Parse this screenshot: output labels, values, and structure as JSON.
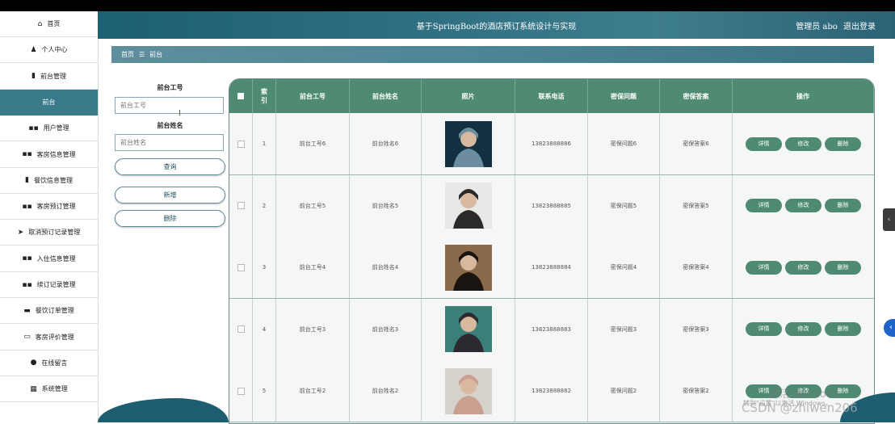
{
  "app": {
    "title": "基于SpringBoot的酒店预订系统设计与实现",
    "user_label": "管理员 abo",
    "logout_label": "退出登录"
  },
  "sidebar": {
    "items": [
      {
        "icon": "⌂",
        "label": "首页"
      },
      {
        "icon": "♟",
        "label": "个人中心"
      },
      {
        "icon": "▮",
        "label": "前台管理"
      },
      {
        "icon": "",
        "label": "前台"
      },
      {
        "icon": "▪▪",
        "label": "用户管理"
      },
      {
        "icon": "▪▪",
        "label": "客房信息管理"
      },
      {
        "icon": "▮",
        "label": "餐饮信息管理"
      },
      {
        "icon": "▪▪",
        "label": "客房预订管理"
      },
      {
        "icon": "➤",
        "label": "取消预订记录管理"
      },
      {
        "icon": "▪▪",
        "label": "入住信息管理"
      },
      {
        "icon": "▪▪",
        "label": "续订记录管理"
      },
      {
        "icon": "▬",
        "label": "餐饮订单管理"
      },
      {
        "icon": "▭",
        "label": "客房评价管理"
      },
      {
        "icon": "●",
        "label": "在线留言"
      },
      {
        "icon": "▦",
        "label": "系统管理"
      }
    ]
  },
  "breadcrumb": {
    "home": "首页",
    "separator": "☰",
    "current": "前台"
  },
  "search": {
    "label1": "前台工号",
    "placeholder1": "前台工号",
    "label2": "前台姓名",
    "placeholder2": "前台姓名",
    "query_btn": "查询",
    "add_btn": "新增",
    "delete_btn": "删除"
  },
  "table": {
    "headers": [
      "索引",
      "前台工号",
      "前台姓名",
      "照片",
      "联系电话",
      "密保问题",
      "密保答案",
      "操作"
    ],
    "actions": {
      "detail": "详情",
      "edit": "修改",
      "delete": "删除"
    },
    "rows": [
      {
        "index": "1",
        "id": "前台工号6",
        "name": "前台姓名6",
        "phone": "13823888886",
        "question": "密保问题6",
        "answer": "密保答案6",
        "photo": "photo-6"
      },
      {
        "index": "2",
        "id": "前台工号5",
        "name": "前台姓名5",
        "phone": "13823888885",
        "question": "密保问题5",
        "answer": "密保答案5",
        "photo": "photo-5"
      },
      {
        "index": "3",
        "id": "前台工号4",
        "name": "前台姓名4",
        "phone": "13823888884",
        "question": "密保问题4",
        "answer": "密保答案4",
        "photo": "photo-4"
      },
      {
        "index": "4",
        "id": "前台工号3",
        "name": "前台姓名3",
        "phone": "13823888883",
        "question": "密保问题3",
        "answer": "密保答案3",
        "photo": "photo-3"
      },
      {
        "index": "5",
        "id": "前台工号2",
        "name": "前台姓名2",
        "phone": "13823888882",
        "question": "密保问题2",
        "answer": "密保答案2",
        "photo": "photo-2"
      }
    ]
  },
  "overlay": {
    "right_tab": "‹",
    "right_circle": "‹",
    "watermark_win": "激活 Windows",
    "watermark_win2": "转到\"设置\"以激活 Windows。",
    "watermark_csdn": "CSDN @zhiwen206"
  },
  "colors": {
    "header": "#1d5f73",
    "accent": "#4f8b73",
    "active": "#3a7a8a"
  }
}
